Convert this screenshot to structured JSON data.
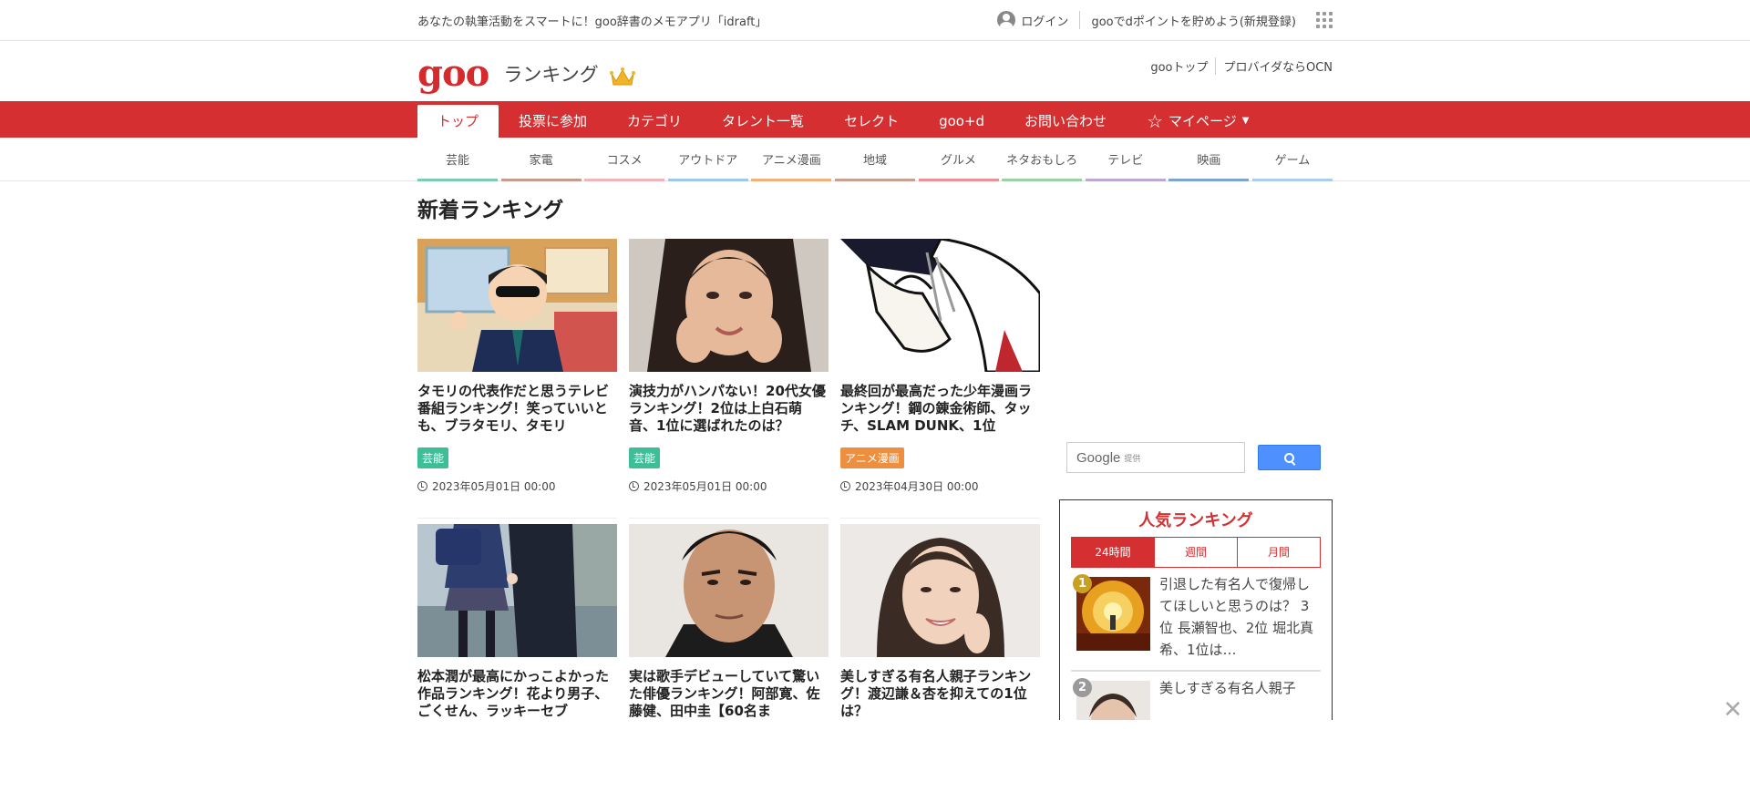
{
  "topbar": {
    "promo": "あなたの執筆活動をスマートに！goo辞書のメモアプリ「idraft」",
    "login": "ログイン",
    "dpoint": "gooでdポイントを貯めよう(新規登録)"
  },
  "header": {
    "logo": "goo",
    "site_name": "ランキング",
    "links": [
      "gooトップ",
      "プロバイダならOCN"
    ]
  },
  "nav": {
    "tabs": [
      "トップ",
      "投票に参加",
      "カテゴリ",
      "タレント一覧",
      "セレクト",
      "goo+d",
      "お問い合わせ",
      "マイページ"
    ]
  },
  "categories": [
    {
      "label": "芸能",
      "color": "#7ccbb4"
    },
    {
      "label": "家電",
      "color": "#c99a8e"
    },
    {
      "label": "コスメ",
      "color": "#f2b3bd"
    },
    {
      "label": "アウトドア",
      "color": "#9ec9e8"
    },
    {
      "label": "アニメ漫画",
      "color": "#f3b07a"
    },
    {
      "label": "地域",
      "color": "#c9a191"
    },
    {
      "label": "グルメ",
      "color": "#ef8f95"
    },
    {
      "label": "ネタおもしろ",
      "color": "#9ad1a5"
    },
    {
      "label": "テレビ",
      "color": "#b9a9d4"
    },
    {
      "label": "映画",
      "color": "#7aa4d3"
    },
    {
      "label": "ゲーム",
      "color": "#a9cdee"
    }
  ],
  "main": {
    "section_title": "新着ランキング",
    "articles": [
      {
        "title": "タモリの代表作だと思うテレビ番組ランキング！笑っていいとも、ブラタモリ、タモリ",
        "tag": "芸能",
        "date": "2023年05月01日 00:00"
      },
      {
        "title": "演技力がハンパない！20代女優ランキング！2位は上白石萌音、1位に選ばれたのは？",
        "tag": "芸能",
        "date": "2023年05月01日 00:00"
      },
      {
        "title": "最終回が最高だった少年漫画ランキング！鋼の錬金術師、タッチ、SLAM DUNK、1位",
        "tag": "アニメ漫画",
        "date": "2023年04月30日 00:00"
      },
      {
        "title": "松本潤が最高にかっこよかった作品ランキング！花より男子、ごくせん、ラッキーセブ"
      },
      {
        "title": "実は歌手デビューしていて驚いた俳優ランキング！阿部寛、佐藤健、田中圭【60名ま"
      },
      {
        "title": "美しすぎる有名人親子ランキング！渡辺謙＆杏を抑えての1位は？"
      }
    ]
  },
  "sidebar": {
    "search_google": "Google",
    "search_provided": "提供",
    "popular_title": "人気ランキング",
    "tabs": [
      "24時間",
      "週間",
      "月間"
    ],
    "items": [
      {
        "rank": "1",
        "text": "引退した有名人で復帰してほしいと思うのは？ 3位 長瀬智也、2位 堀北真希、1位は…"
      },
      {
        "rank": "2",
        "text": "美しすぎる有名人親子"
      }
    ]
  }
}
